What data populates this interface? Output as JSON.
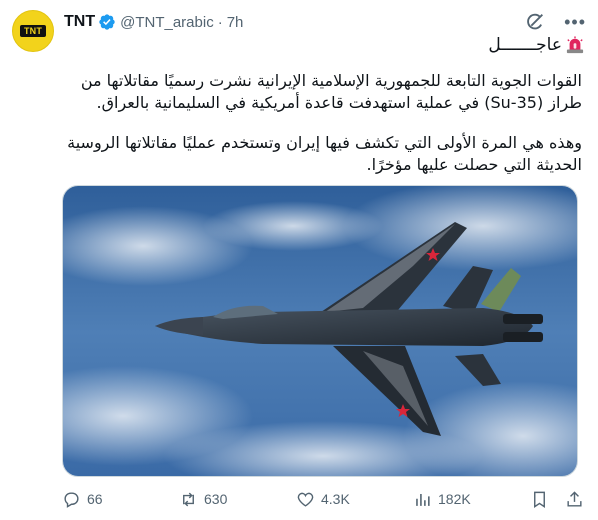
{
  "author": {
    "avatar_text": "TNT",
    "name": "TNT",
    "handle": "@TNT_arabic",
    "separator": "·",
    "time": "7h",
    "brand_color": "#f2d31b"
  },
  "tweet": {
    "badge_emoji": "siren-icon",
    "badge_text": "عاجـــــــل",
    "paragraph_1": "القوات الجوية التابعة للجمهورية الإسلامية الإيرانية نشرت رسميًا مقاتلاتها من طراز (Su-35) في عملية استهدفت قاعدة أمريكية في السليمانية بالعراق.",
    "paragraph_2": "وهذه هي المرة الأولى التي تكشف فيها إيران وتستخدم عمليًا مقاتلاتها الروسية الحديثة التي حصلت عليها مؤخرًا.",
    "media_description_icon": "fighter-jet-photo"
  },
  "actions": {
    "replies": "66",
    "retweets": "630",
    "likes": "4.3K",
    "views": "182K"
  },
  "icons": {
    "grok": "grok-icon",
    "more": "more-icon",
    "reply": "reply-icon",
    "retweet": "retweet-icon",
    "like": "heart-icon",
    "views": "views-icon",
    "bookmark": "bookmark-icon",
    "share": "share-icon"
  },
  "colors": {
    "secondary_text": "#536471",
    "verified_blue": "#1d9bf0",
    "siren_red": "#e0245e"
  }
}
